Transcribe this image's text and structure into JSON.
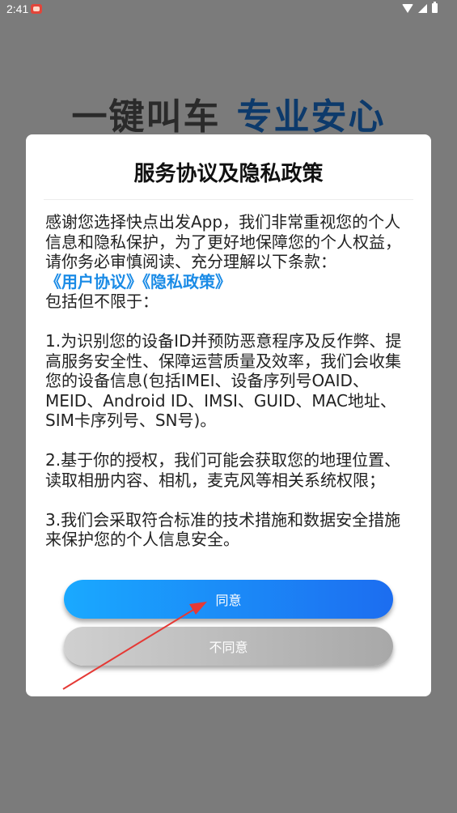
{
  "status_bar": {
    "time": "2:41",
    "icons": [
      "app-notification-icon",
      "wifi-icon",
      "signal-icon",
      "battery-icon"
    ]
  },
  "slogan": {
    "left": "一键叫车",
    "right": "专业安心"
  },
  "dialog": {
    "title": "服务协议及隐私政策",
    "intro": "感谢您选择快点出发App，我们非常重视您的个人信息和隐私保护，为了更好地保障您的个人权益，请你务必审慎阅读、充分理解以下条款：",
    "link_user_agreement": "《用户协议》",
    "link_privacy_policy": "《隐私政策》",
    "including": "包括但不限于：",
    "item1": "1.为识别您的设备ID并预防恶意程序及反作弊、提高服务安全性、保障运营质量及效率，我们会收集您的设备信息(包括IMEI、设备序列号OAID、MEID、Android ID、IMSI、GUID、MAC地址、SIM卡序列号、SN号)。",
    "item2": "2.基于你的授权，我们可能会获取您的地理位置、读取相册内容、相机，麦克风等相关系统权限；",
    "item3": "3.我们会采取符合标准的技术措施和数据安全措施来保护您的个人信息安全。",
    "agree_label": "同意",
    "disagree_label": "不同意"
  },
  "colors": {
    "overlay": "#7b7b7b",
    "link": "#1a8be6",
    "agree_start": "#1aa9ff",
    "agree_end": "#1c6df0",
    "disagree": "#b8b8b8",
    "arrow": "#e53935"
  }
}
